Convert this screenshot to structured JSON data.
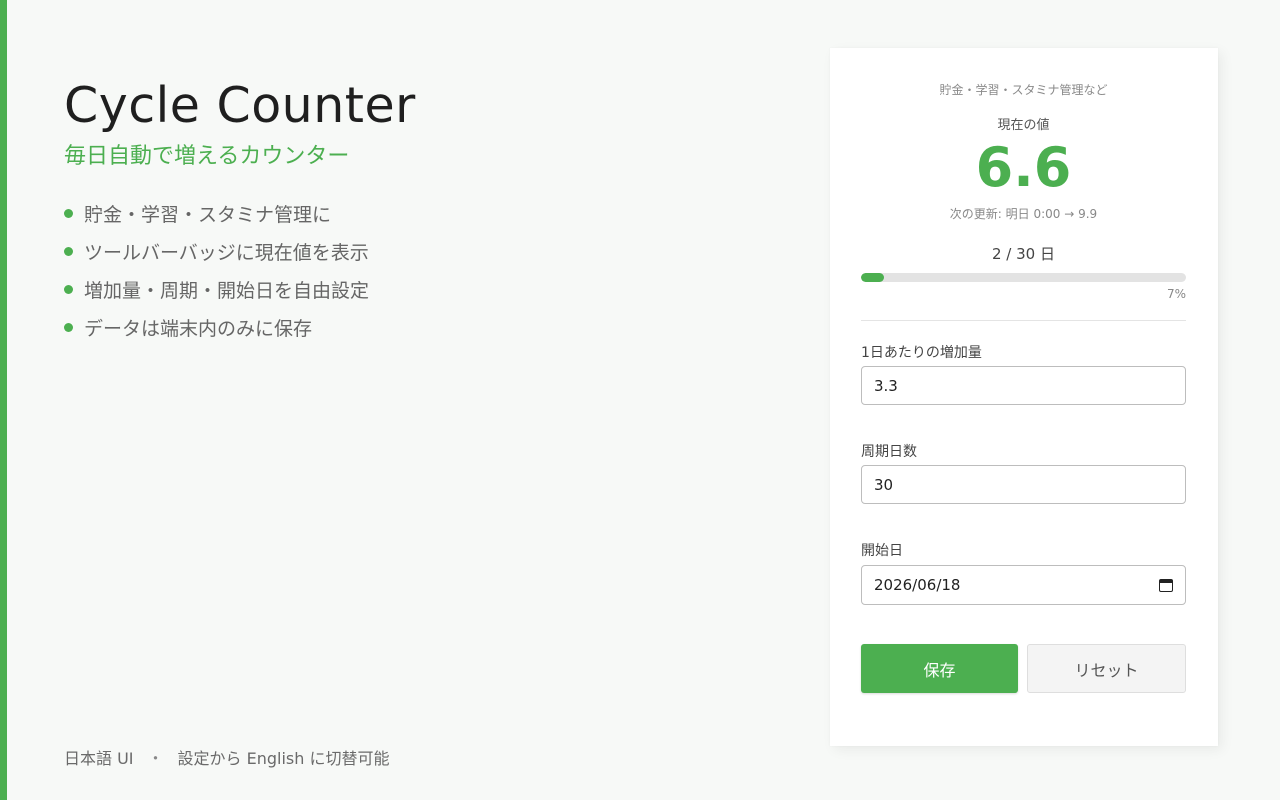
{
  "app": {
    "title": "Cycle Counter",
    "tagline": "毎日自動で増えるカウンター",
    "features": [
      "貯金・学習・スタミナ管理に",
      "ツールバーバッジに現在値を表示",
      "増加量・周期・開始日を自由設定",
      "データは端末内のみに保存"
    ],
    "footer": {
      "language": "日本語 UI",
      "separator": "・",
      "note": "設定から English に切替可能"
    }
  },
  "card": {
    "subtitle": "貯金・学習・スタミナ管理など",
    "current_label": "現在の値",
    "current_value": "6.6",
    "next_update": "次の更新: 明日 0:00 → 9.9",
    "day_counter": "2 / 30 日",
    "progress": {
      "fraction": 0.07,
      "label": "7%"
    },
    "fields": {
      "increment": {
        "label": "1日あたりの増加量",
        "value": "3.3"
      },
      "cycle": {
        "label": "周期日数",
        "value": "30"
      },
      "start": {
        "label": "開始日",
        "value": "2026/06/18",
        "icon": "calendar-icon"
      }
    },
    "buttons": {
      "save": "保存",
      "reset": "リセット"
    }
  },
  "colors": {
    "accent": "#4caf50",
    "background": "#f7f9f7",
    "card": "#ffffff"
  }
}
